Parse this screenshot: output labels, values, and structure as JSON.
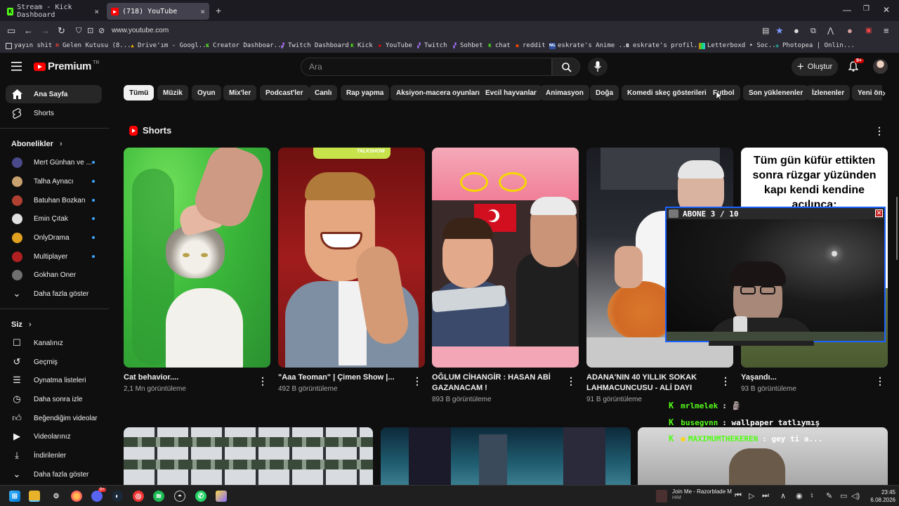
{
  "browser": {
    "tabs": [
      {
        "title": "Stream - Kick Dashboard",
        "active": false
      },
      {
        "title": "(718) YouTube",
        "active": true
      }
    ],
    "new_tab": "+",
    "url": "www.youtube.com",
    "bookmarks": [
      {
        "label": "yayın shit",
        "icon": "folder-icon"
      },
      {
        "label": "Gelen Kutusu (8...",
        "icon": "gmail-icon"
      },
      {
        "label": "Drive'ım - Googl...",
        "icon": "drive-icon"
      },
      {
        "label": "Creator Dashboar...",
        "icon": "kick-icon"
      },
      {
        "label": "Twitch Dashboard",
        "icon": "twitch-icon"
      },
      {
        "label": "Kick",
        "icon": "kick-icon"
      },
      {
        "label": "YouTube",
        "icon": "youtube-icon"
      },
      {
        "label": "Twitch",
        "icon": "twitch-icon"
      },
      {
        "label": "Sohbet",
        "icon": "twitch-icon"
      },
      {
        "label": "chat",
        "icon": "kick-icon"
      },
      {
        "label": "reddit",
        "icon": "reddit-icon"
      },
      {
        "label": "eskrate's Anime ...",
        "icon": "anime-icon"
      },
      {
        "label": "eskrate's profil...",
        "icon": "b-icon"
      },
      {
        "label": "Letterboxd • Soc...",
        "icon": "letterboxd-icon"
      },
      {
        "label": "Photopea | Onlin...",
        "icon": "photopea-icon"
      }
    ]
  },
  "youtube": {
    "logo_word": "Premium",
    "logo_region": "TR",
    "search_placeholder": "Ara",
    "create_label": "Oluştur",
    "notification_count": "9+",
    "sidebar": {
      "main": [
        {
          "label": "Ana Sayfa",
          "icon": "home-icon"
        },
        {
          "label": "Shorts",
          "icon": "shorts-icon"
        }
      ],
      "subscriptions_header": "Abonelikler",
      "subscriptions": [
        {
          "label": "Mert Günhan ve ...",
          "color": "#4a4a8a"
        },
        {
          "label": "Talha Aynacı",
          "color": "#c9a070"
        },
        {
          "label": "Batuhan Bozkan",
          "color": "#b04030"
        },
        {
          "label": "Emin Çıtak",
          "color": "#e0e0e0"
        },
        {
          "label": "OnlyDrama",
          "color": "#e0a020"
        },
        {
          "label": "Multiplayer",
          "color": "#b02020"
        },
        {
          "label": "Gokhan Oner",
          "color": "#707070"
        }
      ],
      "show_more_1": "Daha fazla göster",
      "you_header": "Siz",
      "you_items": [
        {
          "label": "Kanalınız",
          "icon": "channel-icon"
        },
        {
          "label": "Geçmiş",
          "icon": "history-icon"
        },
        {
          "label": "Oynatma listeleri",
          "icon": "playlists-icon"
        },
        {
          "label": "Daha sonra izle",
          "icon": "watch-later-icon"
        },
        {
          "label": "Beğendiğim videolar",
          "icon": "like-icon"
        },
        {
          "label": "Videolarınız",
          "icon": "your-videos-icon"
        },
        {
          "label": "İndirilenler",
          "icon": "download-icon"
        },
        {
          "label": "Daha fazla göster",
          "icon": "chevron-down-icon"
        }
      ]
    },
    "chips": [
      "Tümü",
      "Müzik",
      "Oyun",
      "Mix'ler",
      "Podcast'ler",
      "Canlı",
      "Rap yapma",
      "Aksiyon-macera oyunları",
      "Evcil hayvanlar",
      "Animasyon",
      "Doğa",
      "Komedi skeç gösterileri",
      "Futbol",
      "Son yüklenenler",
      "İzlenenler",
      "Yeni ön"
    ],
    "shorts_header": "Shorts",
    "shorts": [
      {
        "title": "Cat behavior....",
        "views": "2,1 Mn görüntüleme"
      },
      {
        "title": "\"Aaa Teoman\" | Çimen Show |...",
        "views": "492 B görüntüleme"
      },
      {
        "title": "OĞLUM CİHANGİR : HASAN ABİ GAZANACAM !",
        "views": "893 B görüntüleme"
      },
      {
        "title": "ADANA'NIN 40 YILLIK SOKAK LAHMACUNCUSU - ALİ DAYI",
        "views": "91 B görüntüleme"
      },
      {
        "title": "Yaşandı...",
        "views": "93 B görüntüleme"
      }
    ],
    "short5_caption": "Tüm gün küfür ettikten sonra rüzgar yüzünden kapı kendi kendine açılınca:",
    "short2_overlay": "TALKSHOW"
  },
  "overlay": {
    "webcam_title": "ABONE 3 / 10",
    "chat": [
      {
        "user": "mrlmelek",
        "message": ": 🗿"
      },
      {
        "user": "busegvnn",
        "message": ": wallpaper tatlıymış"
      },
      {
        "user": "MAXIMUMTHEKEREN",
        "message": ": gey ti a..."
      }
    ]
  },
  "taskbar": {
    "media_title": "Join Me - Razorblade M",
    "media_artist": "HIM",
    "time": "23:45",
    "date": "6.08.2026",
    "discord_badge": "9+"
  },
  "colors": {
    "youtube_red": "#ff0000",
    "kick_green": "#53fc18",
    "link_blue": "#3ea6ff"
  }
}
